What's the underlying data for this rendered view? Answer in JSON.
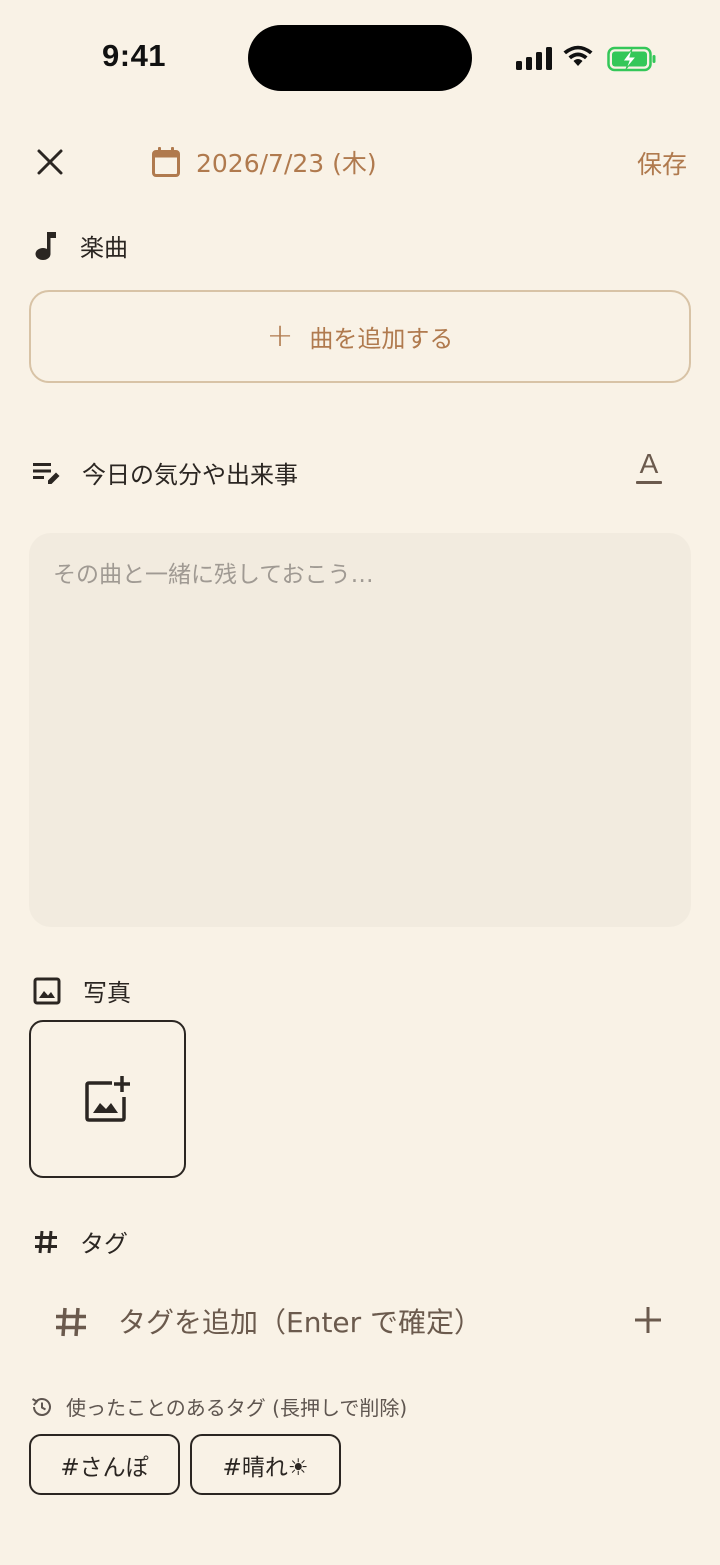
{
  "status_bar": {
    "time": "9:41"
  },
  "header": {
    "date": "2026/7/23 (木)",
    "save_label": "保存"
  },
  "song": {
    "section_label": "楽曲",
    "add_button_label": "曲を追加する"
  },
  "memo": {
    "section_label": "今日の気分や出来事",
    "placeholder": "その曲と一緒に残しておこう…"
  },
  "photo": {
    "section_label": "写真"
  },
  "tags": {
    "section_label": "タグ",
    "input_placeholder": "タグを追加（Enter で確定）",
    "recent_label": "使ったことのあるタグ (長押しで削除)",
    "recent": [
      "#さんぽ",
      "#晴れ☀"
    ]
  },
  "colors": {
    "background": "#f9f2e6",
    "accent": "#b07a4e",
    "memo_background": "#f2ebdf",
    "battery_green": "#34c759"
  },
  "icons": {
    "close": "close-icon",
    "calendar": "calendar-icon",
    "music": "music-note-icon",
    "memo": "edit-note-icon",
    "font": "text-format-icon",
    "photo": "image-icon",
    "add_photo": "add-photo-icon",
    "tag": "hash-icon",
    "history": "history-icon"
  }
}
